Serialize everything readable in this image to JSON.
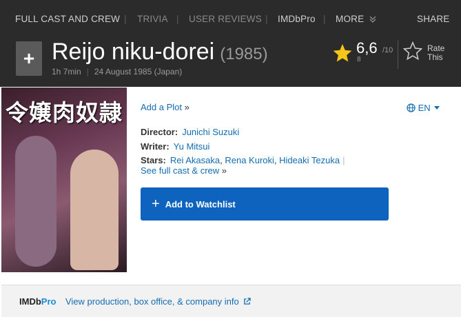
{
  "nav": {
    "full_cast": "FULL CAST AND CREW",
    "trivia": "TRIVIA",
    "user_reviews": "USER REVIEWS",
    "imdbpro": "IMDbPro",
    "more": "MORE",
    "share": "SHARE"
  },
  "title": {
    "name": "Reijo niku-dorei",
    "year": "(1985)",
    "runtime": "1h 7min",
    "release": "24 August 1985 (Japan)"
  },
  "rating": {
    "value": "6,6",
    "max": "/10",
    "count": "8",
    "rate_label_1": "Rate",
    "rate_label_2": "This"
  },
  "poster": {
    "title_text": "令嬢肉奴隷"
  },
  "plot": {
    "add_plot": "Add a Plot",
    "arrow": "»"
  },
  "language": {
    "code": "EN"
  },
  "credits": {
    "director_label": "Director:",
    "director": "Junichi Suzuki",
    "writer_label": "Writer:",
    "writer": "Yu Mitsui",
    "stars_label": "Stars:",
    "stars": [
      "Rei Akasaka",
      "Rena Kuroki",
      "Hideaki Tezuka"
    ],
    "see_full": "See full cast & crew",
    "see_full_arrow": "»"
  },
  "watchlist": {
    "label": "Add to Watchlist"
  },
  "pro": {
    "logo_imdb": "IMDb",
    "logo_pro": "Pro",
    "link": "View production, box office, & company info"
  },
  "colors": {
    "header_bg": "#2b2b2b",
    "link": "#136cb2",
    "watchlist_bg": "#0e63be",
    "star": "#f5c518"
  },
  "icons": [
    "plus-icon",
    "star-icon",
    "star-outline-icon",
    "globe-icon",
    "caret-down-icon",
    "chevron-double-down-icon",
    "external-link-icon"
  ]
}
